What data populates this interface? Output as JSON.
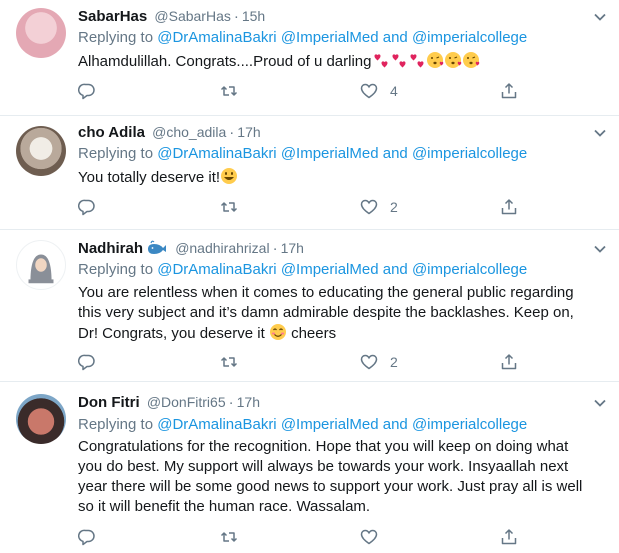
{
  "replying_prefix": "Replying to",
  "mentions": [
    "@DrAmalinaBakri",
    "@ImperialMed",
    "@imperialcollege"
  ],
  "and_word": "and",
  "tweets": [
    {
      "name": "SabarHas",
      "handle": "@SabarHas",
      "time": "15h",
      "text": "Alhamdulillah. Congrats....Proud of u darling",
      "emojis": [
        "two-hearts-icon",
        "two-hearts-icon",
        "two-hearts-icon",
        "kiss-face-icon",
        "kiss-face-icon",
        "kiss-face-icon"
      ],
      "likes": "4"
    },
    {
      "name": "cho Adila",
      "handle": "@cho_adila",
      "time": "17h",
      "text": "You totally deserve it!",
      "emojis": [
        "grin-face-icon"
      ],
      "likes": "2"
    },
    {
      "name": "Nadhirah",
      "handle": "@nadhirahrizal",
      "time": "17h",
      "text_line1": "You are relentless when it comes to educating the general public regarding",
      "text_line2": "this very subject and it’s damn admirable despite the backlashes. Keep on,",
      "text_line3a": "Dr! Congrats, you deserve it",
      "text_line3b": "cheers",
      "emojis": [
        "whale-icon",
        "smile-face-icon"
      ],
      "likes": "2"
    },
    {
      "name": "Don Fitri",
      "handle": "@DonFitri65",
      "time": "17h",
      "text_line1": "Congratulations for the recognition. Hope that you will keep on doing what",
      "text_line2": "you do best. My support will always be towards your work. Insyaallah next",
      "text_line3": "year there will be some good news to support your work. Just pray all is well",
      "text_line4": "so it will benefit the human race. Wassalam."
    }
  ],
  "colors": {
    "link": "#1b95e0",
    "muted": "#657786",
    "text": "#14171a",
    "divider": "#e6ecf0"
  }
}
